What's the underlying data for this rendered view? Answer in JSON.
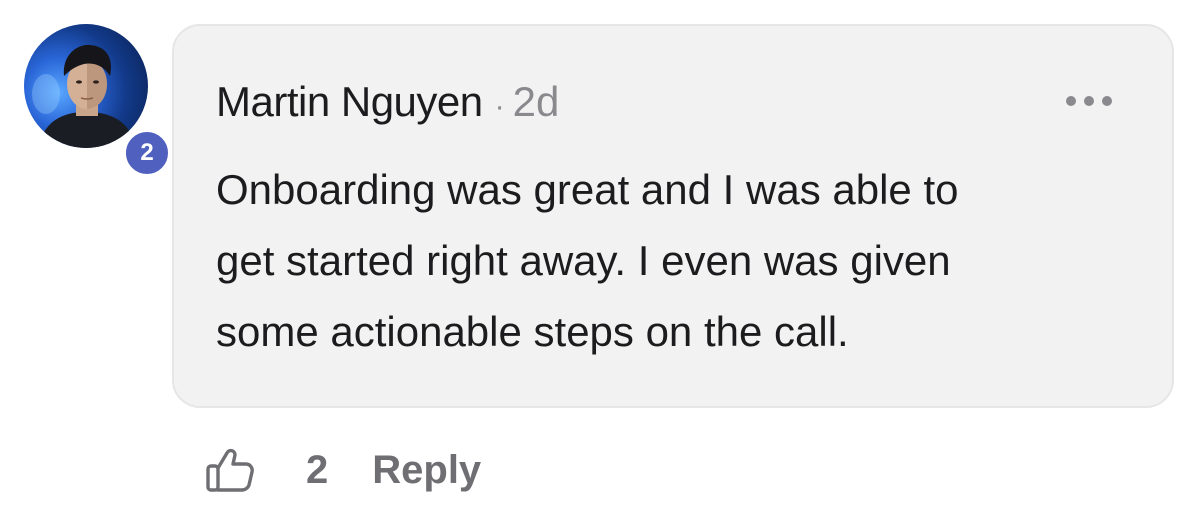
{
  "comment": {
    "author": "Martin Nguyen",
    "separator": "·",
    "timestamp": "2d",
    "avatar_badge": "2",
    "text_lines": [
      "Onboarding was great and I was able to",
      "get started right away. I even was given",
      "some actionable steps on the call."
    ],
    "more_icon": "more-horizontal-icon"
  },
  "actions": {
    "like_icon": "thumbs-up-icon",
    "like_count": "2",
    "reply_label": "Reply"
  },
  "colors": {
    "bubble_background": "#f2f2f3",
    "badge": "#5060bf",
    "muted_text": "#8a8a8e"
  }
}
